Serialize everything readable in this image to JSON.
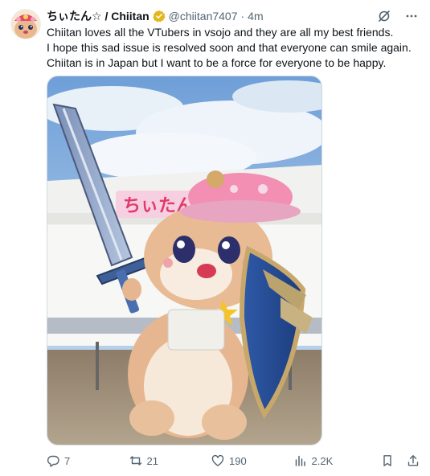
{
  "tweet": {
    "author_name": "ちぃたん☆ / Chiitan",
    "handle": "@chiitan7407",
    "separator": "·",
    "time": "4m",
    "text_lines": [
      "Chiitan loves all the VTubers in vsojo and they are all my best friends.",
      "I hope this sad issue is resolved soon and that everyone can smile again.",
      "Chiitan is in Japan but I want to be a force for everyone to be happy."
    ],
    "image_sign_text": "ちぃたん♪"
  },
  "actions": {
    "reply_count": "7",
    "retweet_count": "21",
    "like_count": "190",
    "view_count": "2.2K"
  },
  "icons": {
    "verified": "verified-badge-icon",
    "grok": "grok-icon",
    "more": "more-options-icon",
    "reply": "reply-icon",
    "retweet": "retweet-icon",
    "like": "like-icon",
    "views": "views-icon",
    "bookmark": "bookmark-icon",
    "share": "share-icon"
  },
  "colors": {
    "text": "#0f1419",
    "secondary": "#536471",
    "verified_gold": "#e2b719"
  }
}
